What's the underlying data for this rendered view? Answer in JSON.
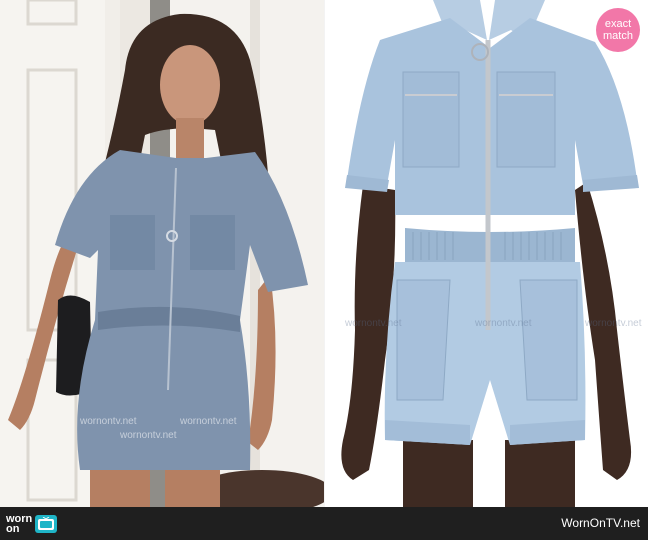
{
  "badge": {
    "line1": "exact",
    "line2": "match"
  },
  "footer": {
    "logo_line1": "worn",
    "logo_line2": "on",
    "site": "WornOnTV.net"
  },
  "watermarks": [
    "wornontv.net",
    "wornontv.net",
    "wornontv.net",
    "wornontv.net",
    "wornontv.net",
    "wornontv.net"
  ],
  "colors": {
    "badge": "#f277a8",
    "footer_bg": "#1f1f1f",
    "tv_icon": "#1fb5c7",
    "denim": "#a9c3dd"
  },
  "icons": {
    "tv": "tv-icon"
  }
}
